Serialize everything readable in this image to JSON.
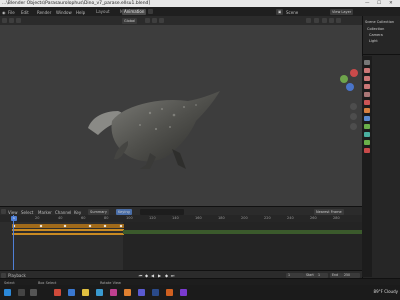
{
  "window": {
    "title": "...\\Blender Objects\\Parasaurolophus\\Dino_v7_parase.ellsu1.blend]",
    "controls": [
      "—",
      "☐",
      "✕"
    ]
  },
  "menus": [
    "File",
    "Edit",
    "Render",
    "Window",
    "Help"
  ],
  "workspace_tabs": [
    "Layout",
    "Modeling",
    "Sculpting",
    "UV Editing",
    "Texture Paint",
    "Shading",
    "Animation",
    "Rendering",
    "Compositing",
    "Scripting"
  ],
  "workspace_active": "Animation",
  "scene": {
    "label": "Scene",
    "view_layer": "View Layer"
  },
  "viewport_header": {
    "orientation": "Global",
    "transform": "Default"
  },
  "outliner": {
    "title": "Scene Collection",
    "items": [
      "Collection",
      "Camera",
      "Light"
    ]
  },
  "timeline": {
    "mode": "Dope Sheet",
    "menus": [
      "View",
      "Select",
      "Marker",
      "Channel",
      "Key"
    ],
    "action": "Summary",
    "only_selected": "Only Show Selected",
    "keying": "Keying",
    "search": "",
    "interpolation": "Nearest Frame",
    "current_frame": "1",
    "ticks": [
      "0",
      "20",
      "40",
      "60",
      "80",
      "100",
      "120",
      "140",
      "160",
      "180",
      "200",
      "220",
      "240",
      "260",
      "280",
      "300"
    ],
    "start": "1",
    "end": "250",
    "frame_field": "1"
  },
  "playback": {
    "label": "Playback",
    "keying_label": "Keying",
    "view_label": "View",
    "marker_label": "Marker",
    "start_label": "Start",
    "end_label": "End"
  },
  "status": {
    "left": "Select",
    "middle": "Box Select",
    "right": "Rotate View",
    "stats": "Collection | Verts 64,258 | Faces 63,740 | Tris 127,480 | Objects 1/3 | Mem: 412 MiB | 2.83.0"
  },
  "taskbar": {
    "weather": "89°F Cloudy",
    "time": ""
  }
}
